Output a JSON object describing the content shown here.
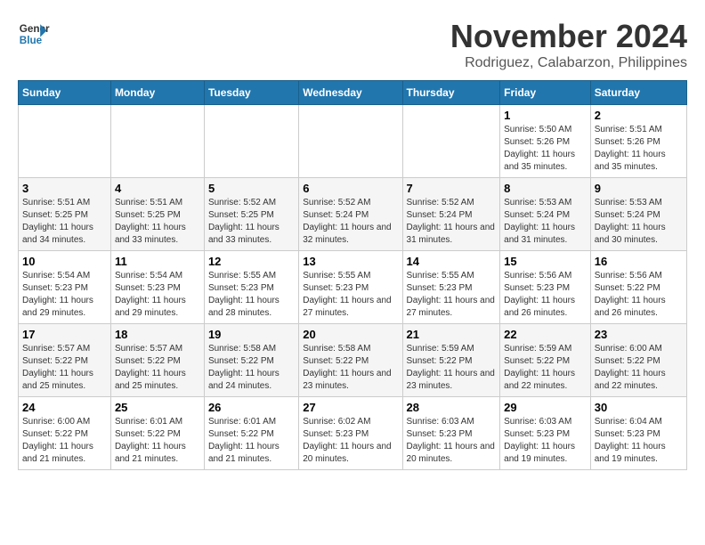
{
  "header": {
    "logo_line1": "General",
    "logo_line2": "Blue",
    "month": "November 2024",
    "location": "Rodriguez, Calabarzon, Philippines"
  },
  "weekdays": [
    "Sunday",
    "Monday",
    "Tuesday",
    "Wednesday",
    "Thursday",
    "Friday",
    "Saturday"
  ],
  "weeks": [
    [
      {
        "day": "",
        "info": ""
      },
      {
        "day": "",
        "info": ""
      },
      {
        "day": "",
        "info": ""
      },
      {
        "day": "",
        "info": ""
      },
      {
        "day": "",
        "info": ""
      },
      {
        "day": "1",
        "info": "Sunrise: 5:50 AM\nSunset: 5:26 PM\nDaylight: 11 hours and 35 minutes."
      },
      {
        "day": "2",
        "info": "Sunrise: 5:51 AM\nSunset: 5:26 PM\nDaylight: 11 hours and 35 minutes."
      }
    ],
    [
      {
        "day": "3",
        "info": "Sunrise: 5:51 AM\nSunset: 5:25 PM\nDaylight: 11 hours and 34 minutes."
      },
      {
        "day": "4",
        "info": "Sunrise: 5:51 AM\nSunset: 5:25 PM\nDaylight: 11 hours and 33 minutes."
      },
      {
        "day": "5",
        "info": "Sunrise: 5:52 AM\nSunset: 5:25 PM\nDaylight: 11 hours and 33 minutes."
      },
      {
        "day": "6",
        "info": "Sunrise: 5:52 AM\nSunset: 5:24 PM\nDaylight: 11 hours and 32 minutes."
      },
      {
        "day": "7",
        "info": "Sunrise: 5:52 AM\nSunset: 5:24 PM\nDaylight: 11 hours and 31 minutes."
      },
      {
        "day": "8",
        "info": "Sunrise: 5:53 AM\nSunset: 5:24 PM\nDaylight: 11 hours and 31 minutes."
      },
      {
        "day": "9",
        "info": "Sunrise: 5:53 AM\nSunset: 5:24 PM\nDaylight: 11 hours and 30 minutes."
      }
    ],
    [
      {
        "day": "10",
        "info": "Sunrise: 5:54 AM\nSunset: 5:23 PM\nDaylight: 11 hours and 29 minutes."
      },
      {
        "day": "11",
        "info": "Sunrise: 5:54 AM\nSunset: 5:23 PM\nDaylight: 11 hours and 29 minutes."
      },
      {
        "day": "12",
        "info": "Sunrise: 5:55 AM\nSunset: 5:23 PM\nDaylight: 11 hours and 28 minutes."
      },
      {
        "day": "13",
        "info": "Sunrise: 5:55 AM\nSunset: 5:23 PM\nDaylight: 11 hours and 27 minutes."
      },
      {
        "day": "14",
        "info": "Sunrise: 5:55 AM\nSunset: 5:23 PM\nDaylight: 11 hours and 27 minutes."
      },
      {
        "day": "15",
        "info": "Sunrise: 5:56 AM\nSunset: 5:23 PM\nDaylight: 11 hours and 26 minutes."
      },
      {
        "day": "16",
        "info": "Sunrise: 5:56 AM\nSunset: 5:22 PM\nDaylight: 11 hours and 26 minutes."
      }
    ],
    [
      {
        "day": "17",
        "info": "Sunrise: 5:57 AM\nSunset: 5:22 PM\nDaylight: 11 hours and 25 minutes."
      },
      {
        "day": "18",
        "info": "Sunrise: 5:57 AM\nSunset: 5:22 PM\nDaylight: 11 hours and 25 minutes."
      },
      {
        "day": "19",
        "info": "Sunrise: 5:58 AM\nSunset: 5:22 PM\nDaylight: 11 hours and 24 minutes."
      },
      {
        "day": "20",
        "info": "Sunrise: 5:58 AM\nSunset: 5:22 PM\nDaylight: 11 hours and 23 minutes."
      },
      {
        "day": "21",
        "info": "Sunrise: 5:59 AM\nSunset: 5:22 PM\nDaylight: 11 hours and 23 minutes."
      },
      {
        "day": "22",
        "info": "Sunrise: 5:59 AM\nSunset: 5:22 PM\nDaylight: 11 hours and 22 minutes."
      },
      {
        "day": "23",
        "info": "Sunrise: 6:00 AM\nSunset: 5:22 PM\nDaylight: 11 hours and 22 minutes."
      }
    ],
    [
      {
        "day": "24",
        "info": "Sunrise: 6:00 AM\nSunset: 5:22 PM\nDaylight: 11 hours and 21 minutes."
      },
      {
        "day": "25",
        "info": "Sunrise: 6:01 AM\nSunset: 5:22 PM\nDaylight: 11 hours and 21 minutes."
      },
      {
        "day": "26",
        "info": "Sunrise: 6:01 AM\nSunset: 5:22 PM\nDaylight: 11 hours and 21 minutes."
      },
      {
        "day": "27",
        "info": "Sunrise: 6:02 AM\nSunset: 5:23 PM\nDaylight: 11 hours and 20 minutes."
      },
      {
        "day": "28",
        "info": "Sunrise: 6:03 AM\nSunset: 5:23 PM\nDaylight: 11 hours and 20 minutes."
      },
      {
        "day": "29",
        "info": "Sunrise: 6:03 AM\nSunset: 5:23 PM\nDaylight: 11 hours and 19 minutes."
      },
      {
        "day": "30",
        "info": "Sunrise: 6:04 AM\nSunset: 5:23 PM\nDaylight: 11 hours and 19 minutes."
      }
    ]
  ]
}
